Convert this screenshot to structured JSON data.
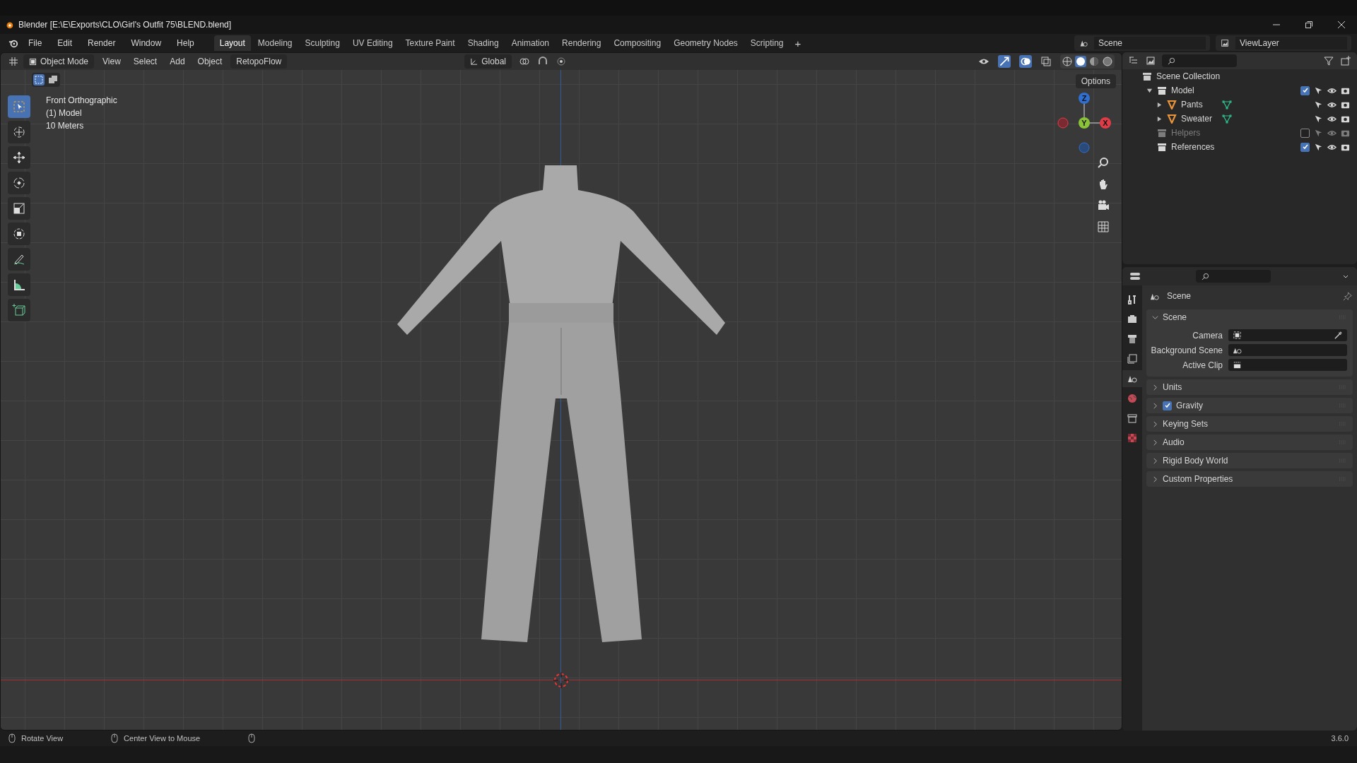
{
  "window": {
    "title": "Blender [E:\\E\\Exports\\CLO\\Girl's Outfit 75\\BLEND.blend]"
  },
  "menu": [
    "File",
    "Edit",
    "Render",
    "Window",
    "Help"
  ],
  "workspaces": [
    {
      "label": "Layout",
      "selected": true
    },
    {
      "label": "Modeling",
      "selected": false
    },
    {
      "label": "Sculpting",
      "selected": false
    },
    {
      "label": "UV Editing",
      "selected": false
    },
    {
      "label": "Texture Paint",
      "selected": false
    },
    {
      "label": "Shading",
      "selected": false
    },
    {
      "label": "Animation",
      "selected": false
    },
    {
      "label": "Rendering",
      "selected": false
    },
    {
      "label": "Compositing",
      "selected": false
    },
    {
      "label": "Geometry Nodes",
      "selected": false
    },
    {
      "label": "Scripting",
      "selected": false
    }
  ],
  "add_workspace": "+",
  "scene_selector": {
    "value": "Scene"
  },
  "view_layer": {
    "value": "ViewLayer"
  },
  "header": {
    "mode": "Object Mode",
    "menus": [
      "View",
      "Select",
      "Add",
      "Object"
    ],
    "addon": "RetopoFlow",
    "orientation": "Global",
    "options": "Options"
  },
  "viewport": {
    "info": [
      "Front Orthographic",
      "(1) Model",
      "10 Meters"
    ],
    "gizmo": [
      {
        "label": "Z",
        "color": "#2f6fcf"
      },
      {
        "label": "Y",
        "color": "#8ac33a"
      },
      {
        "label": "X",
        "color": "#e03c48"
      }
    ],
    "tools": [
      {
        "kind": "select",
        "selected": true
      },
      {
        "kind": "cursor",
        "selected": false
      },
      {
        "kind": "move",
        "selected": false
      },
      {
        "kind": "rotate",
        "selected": false
      },
      {
        "kind": "scale",
        "selected": false
      },
      {
        "kind": "transform",
        "selected": false
      },
      {
        "kind": "annotate",
        "selected": false
      },
      {
        "kind": "measure",
        "selected": false
      },
      {
        "kind": "add-cube",
        "selected": false
      }
    ]
  },
  "outliner": {
    "root": "Scene Collection",
    "items": [
      {
        "label": "Model",
        "kind": "collection",
        "checked": true,
        "disabled": false,
        "expanded": true,
        "children": [
          {
            "label": "Pants",
            "kind": "mesh",
            "expanded": false
          },
          {
            "label": "Sweater",
            "kind": "mesh",
            "expanded": false
          }
        ]
      },
      {
        "label": "Helpers",
        "kind": "collection",
        "checked": false,
        "disabled": true
      },
      {
        "label": "References",
        "kind": "collection",
        "checked": true,
        "disabled": false
      }
    ]
  },
  "properties": {
    "context": "Scene",
    "tabs": [
      {
        "kind": "tool",
        "selected": false
      },
      {
        "kind": "render",
        "selected": false
      },
      {
        "kind": "output",
        "selected": false
      },
      {
        "kind": "view-layer",
        "selected": false
      },
      {
        "kind": "scene",
        "selected": true
      },
      {
        "kind": "world",
        "selected": false
      },
      {
        "kind": "collection",
        "selected": false
      },
      {
        "kind": "texture",
        "selected": false
      }
    ],
    "panels": [
      {
        "title": "Scene",
        "expanded": true,
        "fields": [
          {
            "label": "Camera",
            "kind": "camera"
          },
          {
            "label": "Background Scene",
            "kind": "scene"
          },
          {
            "label": "Active Clip",
            "kind": "clip"
          }
        ]
      },
      {
        "title": "Units",
        "expanded": false
      },
      {
        "title": "Gravity",
        "expanded": false,
        "checked": true
      },
      {
        "title": "Keying Sets",
        "expanded": false
      },
      {
        "title": "Audio",
        "expanded": false
      },
      {
        "title": "Rigid Body World",
        "expanded": false
      },
      {
        "title": "Custom Properties",
        "expanded": false
      }
    ]
  },
  "status_bar": {
    "hints": [
      "Rotate View",
      "Center View to Mouse"
    ],
    "version": "3.6.0"
  }
}
